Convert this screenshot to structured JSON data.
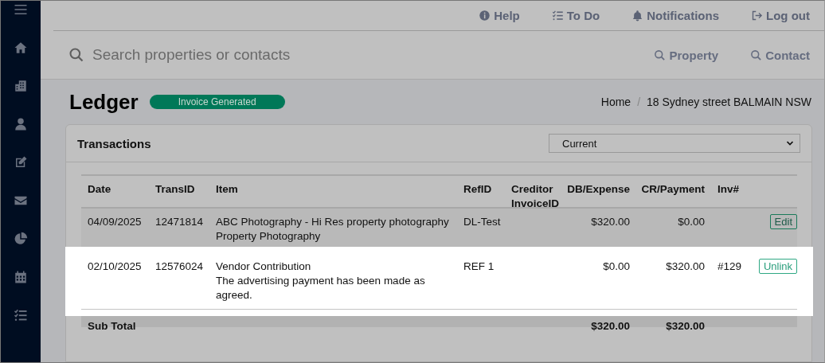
{
  "top_nav": [
    {
      "label": "Help"
    },
    {
      "label": "To Do"
    },
    {
      "label": "Notifications"
    },
    {
      "label": "Log out"
    }
  ],
  "search": {
    "placeholder": "Search properties or contacts"
  },
  "quick_search": [
    {
      "label": "Property"
    },
    {
      "label": "Contact"
    }
  ],
  "page": {
    "title": "Ledger",
    "status": "Invoice Generated"
  },
  "breadcrumb": [
    "Home",
    "18 Sydney street BALMAIN NSW"
  ],
  "breadcrumb_separator": "/",
  "card": {
    "title": "Transactions",
    "period": "Current"
  },
  "table": {
    "columns": [
      "Date",
      "TransID",
      "Item",
      "RefID",
      "Creditor InvoiceID",
      "DB/Expense",
      "CR/Payment",
      "Inv#"
    ],
    "rows": [
      {
        "date": "04/09/2025",
        "trans_id": "12471814",
        "item": [
          "ABC Photography - Hi Res property photography",
          "Property Photography"
        ],
        "ref_id": "DL-Test",
        "db": "$320.00",
        "cr": "$0.00",
        "action": "Edit",
        "highlighted": false
      },
      {
        "date": "02/10/2025",
        "trans_id": "12576024",
        "item": [
          "Vendor Contribution",
          "The advertising payment has been made as agreed."
        ],
        "ref_id": "REF 1",
        "db": "$0.00",
        "cr": "$320.00",
        "inv": "#129",
        "action": "Unlink",
        "highlighted": true
      }
    ],
    "subtotal": {
      "label": "Sub Total",
      "db": "$320.00",
      "cr": "$320.00"
    }
  }
}
